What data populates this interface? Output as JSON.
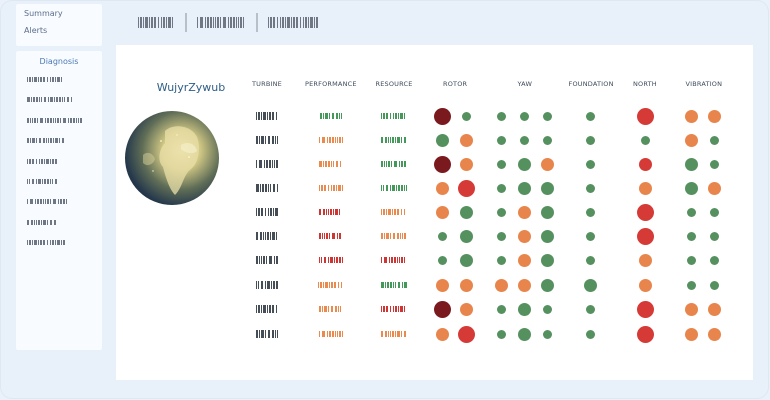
{
  "nav": {
    "summary": "Summary",
    "alerts": "Alerts"
  },
  "sidebar": {
    "title": "Diagnosis",
    "items": [
      "item-1",
      "item-2",
      "item-3",
      "item-4",
      "item-5",
      "item-6",
      "item-7",
      "item-8",
      "item-9"
    ]
  },
  "main": {
    "title": "WujyrZywub",
    "columns": [
      "TURBINE",
      "PERFORMANCE",
      "RESOURCE",
      "ROTOR",
      "YAW",
      "FOUNDATION",
      "NORTH",
      "VIBRATION"
    ]
  },
  "palette": {
    "dark-red": "#7b1a1e",
    "red": "#d53a36",
    "orange": "#e8854c",
    "green": "#55915f",
    "bar-green": "#44985a",
    "bar-orange": "#ea8a4f",
    "bar-red": "#cf3533"
  },
  "rows": [
    {
      "perf": "green",
      "res": "green",
      "dots": [
        [
          "dark-red",
          "L"
        ],
        [
          "green",
          "S"
        ],
        [
          "green",
          "S"
        ],
        [
          "green",
          "S"
        ],
        [
          "green",
          "S"
        ],
        [
          "green",
          "S"
        ],
        [
          "red",
          "L"
        ],
        [
          "orange",
          "M"
        ],
        [
          "orange",
          "M"
        ]
      ]
    },
    {
      "perf": "orange",
      "res": "green",
      "dots": [
        [
          "green",
          "M"
        ],
        [
          "orange",
          "M"
        ],
        [
          "green",
          "S"
        ],
        [
          "green",
          "S"
        ],
        [
          "green",
          "S"
        ],
        [
          "green",
          "S"
        ],
        [
          "green",
          "S"
        ],
        [
          "orange",
          "M"
        ],
        [
          "green",
          "S"
        ]
      ]
    },
    {
      "perf": "orange",
      "res": "green",
      "dots": [
        [
          "dark-red",
          "L"
        ],
        [
          "orange",
          "M"
        ],
        [
          "green",
          "S"
        ],
        [
          "green",
          "M"
        ],
        [
          "orange",
          "M"
        ],
        [
          "green",
          "S"
        ],
        [
          "red",
          "M"
        ],
        [
          "green",
          "M"
        ],
        [
          "green",
          "S"
        ]
      ]
    },
    {
      "perf": "orange",
      "res": "green",
      "dots": [
        [
          "orange",
          "M"
        ],
        [
          "red",
          "L"
        ],
        [
          "green",
          "S"
        ],
        [
          "green",
          "M"
        ],
        [
          "green",
          "M"
        ],
        [
          "green",
          "S"
        ],
        [
          "orange",
          "M"
        ],
        [
          "green",
          "M"
        ],
        [
          "orange",
          "M"
        ]
      ]
    },
    {
      "perf": "red",
      "res": "orange",
      "dots": [
        [
          "orange",
          "M"
        ],
        [
          "green",
          "M"
        ],
        [
          "green",
          "S"
        ],
        [
          "orange",
          "M"
        ],
        [
          "green",
          "M"
        ],
        [
          "green",
          "S"
        ],
        [
          "red",
          "L"
        ],
        [
          "green",
          "S"
        ],
        [
          "green",
          "S"
        ]
      ]
    },
    {
      "perf": "red",
      "res": "orange",
      "dots": [
        [
          "green",
          "S"
        ],
        [
          "green",
          "M"
        ],
        [
          "green",
          "S"
        ],
        [
          "orange",
          "M"
        ],
        [
          "green",
          "M"
        ],
        [
          "green",
          "S"
        ],
        [
          "red",
          "L"
        ],
        [
          "green",
          "S"
        ],
        [
          "green",
          "S"
        ]
      ]
    },
    {
      "perf": "red",
      "res": "red",
      "dots": [
        [
          "green",
          "S"
        ],
        [
          "green",
          "M"
        ],
        [
          "green",
          "S"
        ],
        [
          "orange",
          "M"
        ],
        [
          "green",
          "M"
        ],
        [
          "green",
          "S"
        ],
        [
          "orange",
          "M"
        ],
        [
          "green",
          "S"
        ],
        [
          "green",
          "S"
        ]
      ]
    },
    {
      "perf": "orange",
      "res": "green",
      "dots": [
        [
          "orange",
          "M"
        ],
        [
          "orange",
          "M"
        ],
        [
          "orange",
          "M"
        ],
        [
          "orange",
          "M"
        ],
        [
          "green",
          "M"
        ],
        [
          "green",
          "M"
        ],
        [
          "orange",
          "M"
        ],
        [
          "green",
          "S"
        ],
        [
          "green",
          "S"
        ]
      ]
    },
    {
      "perf": "orange",
      "res": "red",
      "dots": [
        [
          "dark-red",
          "L"
        ],
        [
          "orange",
          "M"
        ],
        [
          "green",
          "S"
        ],
        [
          "green",
          "M"
        ],
        [
          "green",
          "S"
        ],
        [
          "green",
          "S"
        ],
        [
          "red",
          "L"
        ],
        [
          "orange",
          "M"
        ],
        [
          "orange",
          "M"
        ]
      ]
    },
    {
      "perf": "orange",
      "res": "orange",
      "dots": [
        [
          "orange",
          "M"
        ],
        [
          "red",
          "L"
        ],
        [
          "green",
          "S"
        ],
        [
          "green",
          "M"
        ],
        [
          "green",
          "S"
        ],
        [
          "green",
          "S"
        ],
        [
          "red",
          "L"
        ],
        [
          "orange",
          "M"
        ],
        [
          "orange",
          "M"
        ]
      ]
    }
  ]
}
